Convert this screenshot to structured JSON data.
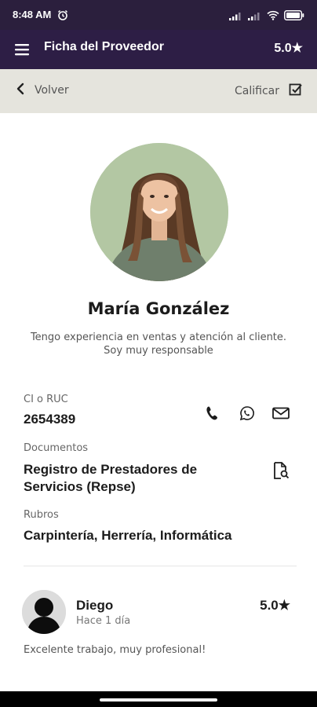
{
  "status": {
    "time": "8:48 AM"
  },
  "app_bar": {
    "title": "Ficha del Proveedor",
    "rating": "5.0★"
  },
  "sub_bar": {
    "back_label": "Volver",
    "rate_label": "Calificar"
  },
  "profile": {
    "name": "María González",
    "bio_line1": "Tengo experiencia en ventas y atención al cliente.",
    "bio_line2": "Soy muy responsable"
  },
  "fields": {
    "ci_label": "CI o RUC",
    "ci_value": "2654389",
    "documents_label": "Documentos",
    "documents_value": "Registro de Prestadores de Servicios (Repse)",
    "rubros_label": "Rubros",
    "rubros_value": "Carpintería, Herrería, Informática"
  },
  "review": {
    "author": "Diego",
    "time_ago": "Hace 1 día",
    "rating": "5.0★",
    "text": "Excelente trabajo, muy profesional!"
  },
  "colors": {
    "status_bar": "#2b1f3d",
    "app_bar": "#2d1e45",
    "sub_bar": "#e5e4dd"
  },
  "icons": [
    "alarm-icon",
    "signal-icon",
    "wifi-icon",
    "battery-icon",
    "menu-icon",
    "chevron-left-icon",
    "checkbox-icon",
    "phone-icon",
    "whatsapp-icon",
    "mail-icon",
    "document-search-icon"
  ]
}
